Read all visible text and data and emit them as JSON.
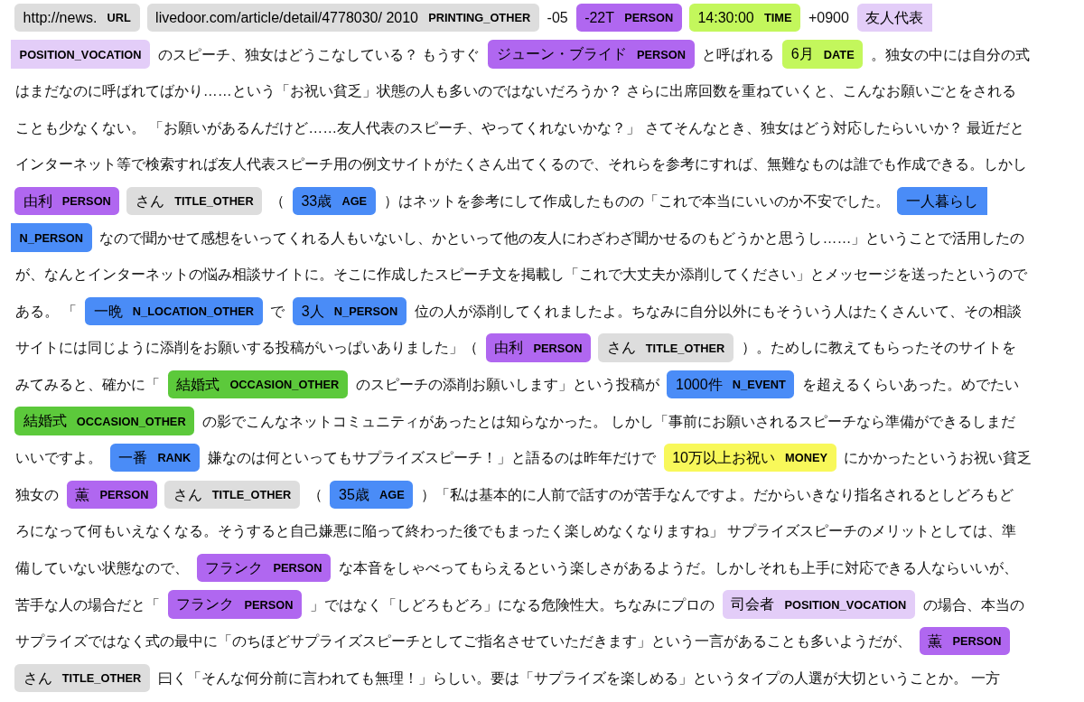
{
  "lines": [
    [
      {
        "kind": "entity",
        "text": "http://news.",
        "label": "URL",
        "color": "#dddddd"
      },
      {
        "kind": "entity",
        "text": "livedoor.com/article/detail/4778030/ 2010",
        "label": "PRINTING_OTHER",
        "color": "#dddddd"
      },
      {
        "kind": "text",
        "text": "-05"
      },
      {
        "kind": "entity",
        "text": "-22T",
        "label": "PERSON",
        "color": "#b067f0"
      },
      {
        "kind": "entity",
        "text": "14:30:00",
        "label": "TIME",
        "color": "#c3f75c"
      },
      {
        "kind": "text",
        "text": "+0900"
      },
      {
        "kind": "entity",
        "text": "友人代表",
        "color": "#e3cdf8"
      }
    ],
    [
      {
        "kind": "entity",
        "label": "POSITION_VOCATION",
        "color": "#e3cdf8"
      },
      {
        "kind": "text",
        "text": "のスピーチ、独女はどうこなしている？ もうすぐ"
      },
      {
        "kind": "entity",
        "text": "ジューン・ブライド",
        "label": "PERSON",
        "color": "#b067f0"
      },
      {
        "kind": "text",
        "text": "と呼ばれる"
      },
      {
        "kind": "entity",
        "text": "6月",
        "label": "DATE",
        "color": "#c3f75c"
      },
      {
        "kind": "text",
        "text": "。独女の中には自分の式"
      }
    ],
    [
      {
        "kind": "text",
        "text": "はまだなのに呼ばれてばかり……という「お祝い貧乏」状態の人も多いのではないだろうか？ さらに出席回数を重ねていくと、こんなお願いごとをされる"
      }
    ],
    [
      {
        "kind": "text",
        "text": "ことも少なくない。 「お願いがあるんだけど……友人代表のスピーチ、やってくれないかな？」 さてそんなとき、独女はどう対応したらいいか？ 最近だと"
      }
    ],
    [
      {
        "kind": "text",
        "text": "インターネット等で検索すれば友人代表スピーチ用の例文サイトがたくさん出てくるので、それらを参考にすれば、無難なものは誰でも作成できる。しかし"
      }
    ],
    [
      {
        "kind": "entity",
        "text": "由利",
        "label": "PERSON",
        "color": "#b067f0"
      },
      {
        "kind": "entity",
        "text": "さん",
        "label": "TITLE_OTHER",
        "color": "#dddddd"
      },
      {
        "kind": "text",
        "text": "（"
      },
      {
        "kind": "entity",
        "text": "33歳",
        "label": "AGE",
        "color": "#4a8cf7"
      },
      {
        "kind": "text",
        "text": "）はネットを参考にして作成したものの「これで本当にいいのか不安でした。"
      },
      {
        "kind": "entity",
        "text": "一人暮らし",
        "color": "#4a8cf7"
      }
    ],
    [
      {
        "kind": "entity",
        "label": "N_PERSON",
        "color": "#4a8cf7"
      },
      {
        "kind": "text",
        "text": "なので聞かせて感想をいってくれる人もいないし、かといって他の友人にわざわざ聞かせるのもどうかと思うし……」ということで活用したの"
      }
    ],
    [
      {
        "kind": "text",
        "text": "が、なんとインターネットの悩み相談サイトに。そこに作成したスピーチ文を掲載し「これで大丈夫か添削してください」とメッセージを送ったというので"
      }
    ],
    [
      {
        "kind": "text",
        "text": "ある。 「"
      },
      {
        "kind": "entity",
        "text": "一晩",
        "label": "N_LOCATION_OTHER",
        "color": "#4a8cf7"
      },
      {
        "kind": "text",
        "text": "で"
      },
      {
        "kind": "entity",
        "text": "3人",
        "label": "N_PERSON",
        "color": "#4a8cf7"
      },
      {
        "kind": "text",
        "text": "位の人が添削してくれましたよ。ちなみに自分以外にもそういう人はたくさんいて、その相談"
      }
    ],
    [
      {
        "kind": "text",
        "text": "サイトには同じように添削をお願いする投稿がいっぱいありました」（"
      },
      {
        "kind": "entity",
        "text": "由利",
        "label": "PERSON",
        "color": "#b067f0"
      },
      {
        "kind": "entity",
        "text": "さん",
        "label": "TITLE_OTHER",
        "color": "#dddddd"
      },
      {
        "kind": "text",
        "text": "）。ためしに教えてもらったそのサイトを"
      }
    ],
    [
      {
        "kind": "text",
        "text": "みてみると、確かに「"
      },
      {
        "kind": "entity",
        "text": "結婚式",
        "label": "OCCASION_OTHER",
        "color": "#5cc93b"
      },
      {
        "kind": "text",
        "text": "のスピーチの添削お願いします」という投稿が"
      },
      {
        "kind": "entity",
        "text": "1000件",
        "label": "N_EVENT",
        "color": "#4a8cf7"
      },
      {
        "kind": "text",
        "text": "を超えるくらいあった。めでたい"
      }
    ],
    [
      {
        "kind": "entity",
        "text": "結婚式",
        "label": "OCCASION_OTHER",
        "color": "#5cc93b"
      },
      {
        "kind": "text",
        "text": "の影でこんなネットコミュニティがあったとは知らなかった。 しかし「事前にお願いされるスピーチなら準備ができるしまだ"
      }
    ],
    [
      {
        "kind": "text",
        "text": "いいですよ。"
      },
      {
        "kind": "entity",
        "text": "一番",
        "label": "RANK",
        "color": "#4a8cf7"
      },
      {
        "kind": "text",
        "text": "嫌なのは何といってもサプライズスピーチ！」と語るのは昨年だけで"
      },
      {
        "kind": "entity",
        "text": "10万以上お祝い",
        "label": "MONEY",
        "color": "#f8f85a"
      },
      {
        "kind": "text",
        "text": "にかかったというお祝い貧乏"
      }
    ],
    [
      {
        "kind": "text",
        "text": "独女の"
      },
      {
        "kind": "entity",
        "text": "薫",
        "label": "PERSON",
        "color": "#b067f0"
      },
      {
        "kind": "entity",
        "text": "さん",
        "label": "TITLE_OTHER",
        "color": "#dddddd"
      },
      {
        "kind": "text",
        "text": "（"
      },
      {
        "kind": "entity",
        "text": "35歳",
        "label": "AGE",
        "color": "#4a8cf7"
      },
      {
        "kind": "text",
        "text": "）「私は基本的に人前で話すのが苦手なんですよ。だからいきなり指名されるとしどろもど"
      }
    ],
    [
      {
        "kind": "text",
        "text": "ろになって何もいえなくなる。そうすると自己嫌悪に陥って終わった後でもまったく楽しめなくなりますね」 サプライズスピーチのメリットとしては、準"
      }
    ],
    [
      {
        "kind": "text",
        "text": "備していない状態なので、"
      },
      {
        "kind": "entity",
        "text": "フランク",
        "label": "PERSON",
        "color": "#b067f0"
      },
      {
        "kind": "text",
        "text": "な本音をしゃべってもらえるという楽しさがあるようだ。しかしそれも上手に対応できる人ならいいが、"
      }
    ],
    [
      {
        "kind": "text",
        "text": "苦手な人の場合だと「"
      },
      {
        "kind": "entity",
        "text": "フランク",
        "label": "PERSON",
        "color": "#b067f0"
      },
      {
        "kind": "text",
        "text": "」ではなく「しどろもどろ」になる危険性大。ちなみにプロの"
      },
      {
        "kind": "entity",
        "text": "司会者",
        "label": "POSITION_VOCATION",
        "color": "#e3cdf8"
      },
      {
        "kind": "text",
        "text": "の場合、本当の"
      }
    ],
    [
      {
        "kind": "text",
        "text": "サプライズではなく式の最中に「のちほどサプライズスピーチとしてご指名させていただきます」という一言があることも多いようだが、"
      },
      {
        "kind": "entity",
        "text": "薫",
        "label": "PERSON",
        "color": "#b067f0"
      }
    ],
    [
      {
        "kind": "entity",
        "text": "さん",
        "label": "TITLE_OTHER",
        "color": "#dddddd"
      },
      {
        "kind": "text",
        "text": "曰く「そんな何分前に言われても無理！」らしい。要は「サプライズを楽しめる」というタイプの人選が大切ということか。 一方"
      }
    ]
  ]
}
